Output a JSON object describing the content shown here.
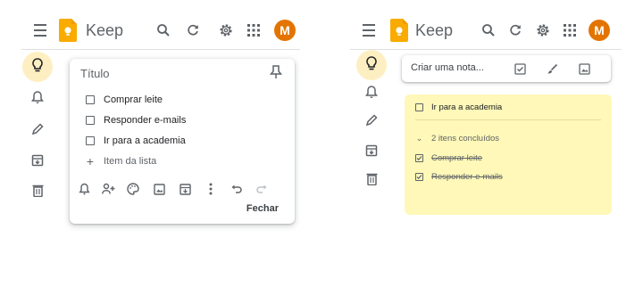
{
  "colors": {
    "accent": "#f9ab00",
    "avatar": "#e37400",
    "note_yellow": "#fff8b8",
    "active_nav": "#feefc3"
  },
  "header": {
    "app_title": "Keep",
    "avatar_initial": "M"
  },
  "sidebar": {
    "items": [
      "lightbulb-icon",
      "bell-icon",
      "pencil-icon",
      "archive-icon",
      "trash-icon"
    ]
  },
  "left": {
    "note": {
      "title_placeholder": "Título",
      "items": [
        "Comprar leite",
        "Responder e-mails",
        "Ir para a academia"
      ],
      "add_item_label": "Item da lista",
      "close_label": "Fechar"
    }
  },
  "right": {
    "take_note_placeholder": "Criar uma nota...",
    "note": {
      "open_item": "Ir para a academia",
      "completed_label": "2 itens concluídos",
      "done_items": [
        "Comprar leite",
        "Responder e-mails"
      ]
    }
  }
}
